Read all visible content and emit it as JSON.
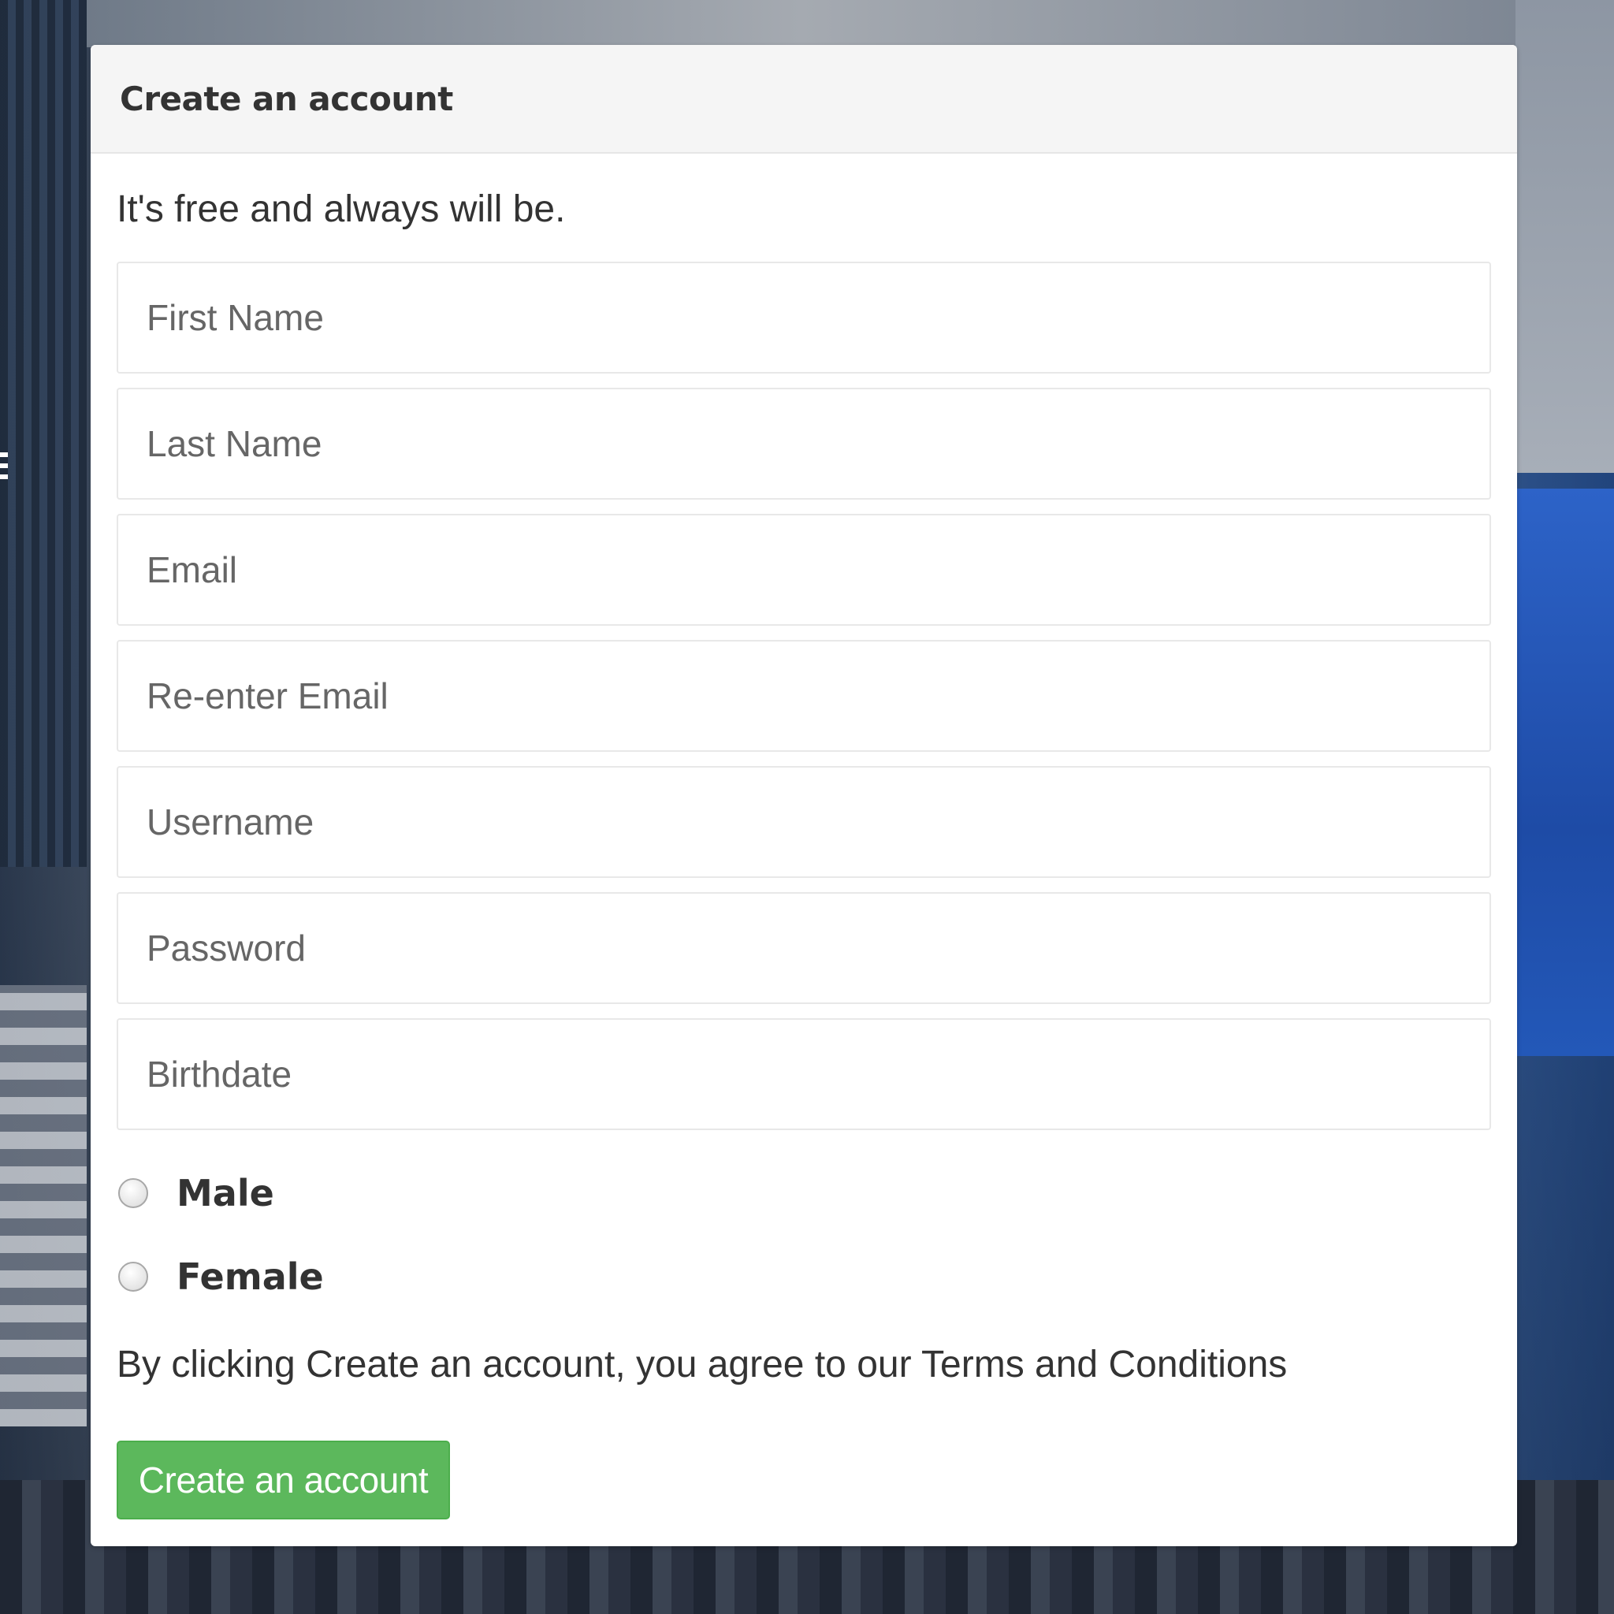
{
  "form": {
    "title": "Create an account",
    "subtitle": "It's free and always will be.",
    "fields": {
      "first_name": "First Name",
      "last_name": "Last Name",
      "email": "Email",
      "reenter_email": "Re-enter Email",
      "username": "Username",
      "password": "Password",
      "birthdate": "Birthdate"
    },
    "gender": {
      "male": "Male",
      "female": "Female"
    },
    "terms_prefix": "By clicking Create an account, you agree to our ",
    "terms_link": "Terms and Conditions",
    "submit_label": "Create an account"
  },
  "colors": {
    "submit_bg": "#5cb85c",
    "heading_bg": "#f5f5f5"
  }
}
